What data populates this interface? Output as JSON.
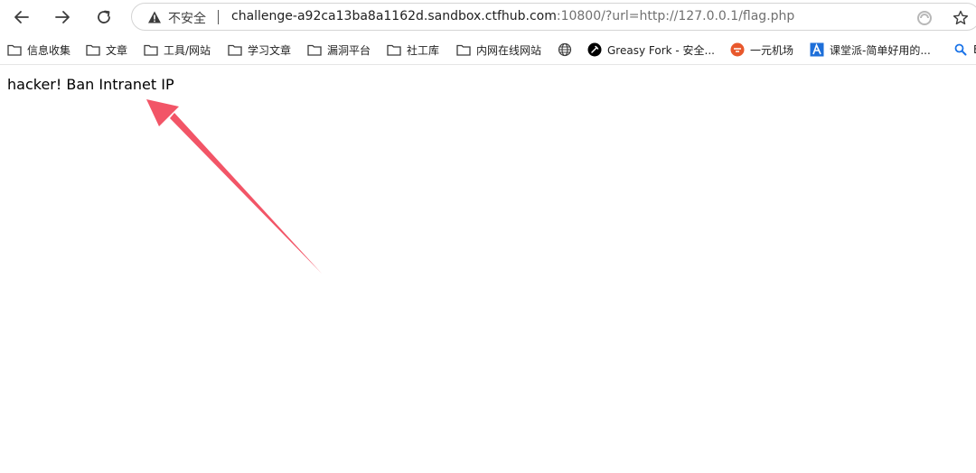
{
  "toolbar": {
    "insecure_label": "不安全",
    "url_host": "challenge-a92ca13ba8a1162d.sandbox.ctfhub.com",
    "url_rest": ":10800/?url=http://127.0.0.1/flag.php"
  },
  "bookmarks": [
    {
      "label": "信息收集",
      "icon": "folder-icon"
    },
    {
      "label": "文章",
      "icon": "folder-icon"
    },
    {
      "label": "工具/网站",
      "icon": "folder-icon"
    },
    {
      "label": "学习文章",
      "icon": "folder-icon"
    },
    {
      "label": "漏洞平台",
      "icon": "folder-icon"
    },
    {
      "label": "社工库",
      "icon": "folder-icon"
    },
    {
      "label": "内网在线网站",
      "icon": "folder-icon"
    },
    {
      "label": "",
      "icon": "globe-icon"
    },
    {
      "label": "Greasy Fork - 安全...",
      "icon": "greasyfork-icon"
    },
    {
      "label": "一元机场",
      "icon": "orange-circle-icon"
    },
    {
      "label": "课堂派-简单好用的...",
      "icon": "ketangpai-icon"
    },
    {
      "label": "E",
      "icon": "search-icon"
    }
  ],
  "page": {
    "message": "hacker! Ban Intranet IP"
  },
  "colors": {
    "annotation_arrow": "#f25567"
  }
}
